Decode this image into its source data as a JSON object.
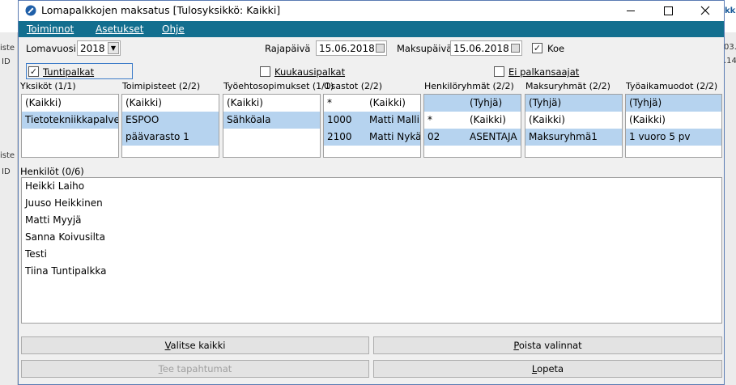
{
  "background": {
    "left_fragments": [
      "iste",
      "ID",
      "iste",
      "ID"
    ],
    "right_fragments": [
      "kk",
      "03.",
      ".14"
    ]
  },
  "window": {
    "title": "Lomapalkkojen maksatus [Tulosyksikkö: Kaikki]",
    "controls": {
      "minimize": "—",
      "maximize": "☐",
      "close": "✕"
    }
  },
  "menu": [
    {
      "key": "T",
      "rest": "oiminnot"
    },
    {
      "key": "A",
      "rest": "setukset"
    },
    {
      "key": "O",
      "rest": "hje"
    }
  ],
  "filters": {
    "lomavuosi": {
      "label": "Lomavuosi",
      "value": "2018"
    },
    "rajapaiva": {
      "label": "Rajapäivä",
      "value": "15.06.2018"
    },
    "maksupaiva": {
      "label": "Maksupäivä",
      "value": "15.06.2018"
    },
    "koe": {
      "label": "Koe",
      "checked": true
    }
  },
  "checkboxes": {
    "tuntipalkat": {
      "label": "Tuntipalkat",
      "checked": true
    },
    "kuukausipalkat": {
      "label": "Kuukausipalkat",
      "checked": false
    },
    "ei_palkansaajat": {
      "label": "Ei palkansaajat",
      "checked": false
    }
  },
  "lists": {
    "yksikot": {
      "header": "Yksiköt (1/1)",
      "rows": [
        "(Kaikki)",
        "Tietotekniikkapalvelu"
      ]
    },
    "toimipisteet": {
      "header": "Toimipisteet (2/2)",
      "rows": [
        "(Kaikki)",
        "ESPOO",
        "päävarasto 1"
      ]
    },
    "tyoehtosopimukset": {
      "header": "Työehtosopimukset (1/1)",
      "rows": [
        "(Kaikki)",
        "Sähköala"
      ]
    },
    "osastot": {
      "header": "Osastot (2/2)",
      "rows": [
        {
          "code": "*",
          "name": "(Kaikki)"
        },
        {
          "code": "1000",
          "name": "Matti Mallik"
        },
        {
          "code": "2100",
          "name": "Matti Nykän"
        }
      ]
    },
    "henkiloryhmat": {
      "header": "Henkilöryhmät (2/2)",
      "rows": [
        {
          "code": "",
          "name": "(Tyhjä)"
        },
        {
          "code": "*",
          "name": "(Kaikki)"
        },
        {
          "code": "02",
          "name": "ASENTAJA"
        }
      ]
    },
    "maksuryhmat": {
      "header": "Maksuryhmät (2/2)",
      "rows": [
        "(Tyhjä)",
        "(Kaikki)",
        "Maksuryhmä1"
      ]
    },
    "tyoaikamuodot": {
      "header": "Työaikamuodot (2/2)",
      "rows": [
        "(Tyhjä)",
        "(Kaikki)",
        "1 vuoro 5 pv"
      ]
    }
  },
  "henkilot": {
    "header": "Henkilöt (0/6)",
    "rows": [
      "Heikki Laiho",
      "Juuso Heikkinen",
      "Matti Myyjä",
      "Sanna Koivusilta",
      "Testi",
      "Tiina Tuntipalkka"
    ]
  },
  "buttons": {
    "valitse_kaikki": {
      "key": "V",
      "rest": "alitse kaikki"
    },
    "poista_valinnat": {
      "key": "P",
      "rest": "oista valinnat"
    },
    "tee_tapahtumat": {
      "key": "T",
      "rest": "ee tapahtumat"
    },
    "lopeta": {
      "key": "L",
      "rest": "opeta"
    }
  },
  "colors": {
    "menubar": "#136f8f",
    "selection": "#b6d3ef"
  }
}
